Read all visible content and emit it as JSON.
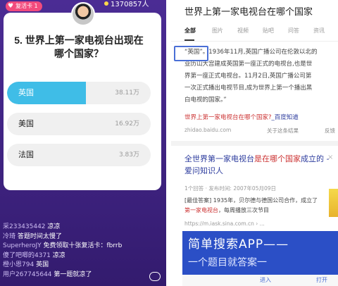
{
  "quiz": {
    "revive_card": "复活卡 1",
    "viewer_count": "1370857人",
    "question": "5. 世界上第一家电视台出现在哪个国家？",
    "options": [
      {
        "label": "英国",
        "count": "38.11万",
        "selected": true,
        "share": 0.55
      },
      {
        "label": "美国",
        "count": "16.92万",
        "selected": false,
        "share": 0
      },
      {
        "label": "法国",
        "count": "3.83万",
        "selected": false,
        "share": 0
      }
    ],
    "chat": [
      {
        "user": "采233435442",
        "text": "凉凉"
      },
      {
        "user": "冷琦",
        "text": "答题时间太慢了"
      },
      {
        "user": "SuperheroJY",
        "text": "免费领取十张复活卡：fbrrb"
      },
      {
        "user": "傻了吧唧的4371",
        "text": "凉凉"
      },
      {
        "user": "橙小恩794",
        "text": "英国"
      },
      {
        "user": "用户267745644",
        "text": "第一题就凉了"
      }
    ]
  },
  "search": {
    "title": "世界上第一家电视台在哪个国家",
    "tabs": [
      "全部",
      "图片",
      "视频",
      "贴吧",
      "问答",
      "资讯"
    ],
    "snippet_lines": [
      "“英国”。1936年11月,英国广播公司在伦敦以北的",
      "亚历山大宫建成英国第一座正式的电视台,也是世",
      "界第一座正式电视台。11月2日,英国广播公司第",
      "一次正式播出电视节目,成为世界上第一个播出黑",
      "白电视的国家。”"
    ],
    "result1_link": "世界上第一家电视台在哪个国家?",
    "result1_link_tail": "_百度知道",
    "result1_source": "zhidao.baidu.com",
    "result1_thanks": "关于这条结果",
    "result1_feedback": "反馈",
    "result2_title_a": "全世界第一家电视台",
    "result2_title_b": "是在哪个国家",
    "result2_title_c": "成立的 - 爱问知识人",
    "result2_dismiss": "×",
    "result2_meta": "1个回答 · 发布时间: 2007年05月09日",
    "result2_answer_line1": "[最佳答案] 1935年，贝尔德与德国公司合作，成立了",
    "result2_answer_hl": "第一家电视台",
    "result2_answer_tail": "，每周播放三次节目",
    "result2_url": "https://m.iask.sina.com.cn › ...",
    "banner_title": "简单搜索APP——",
    "banner_sub": "一个题目就答案一",
    "nav_left": "进入",
    "nav_right": "打开"
  }
}
